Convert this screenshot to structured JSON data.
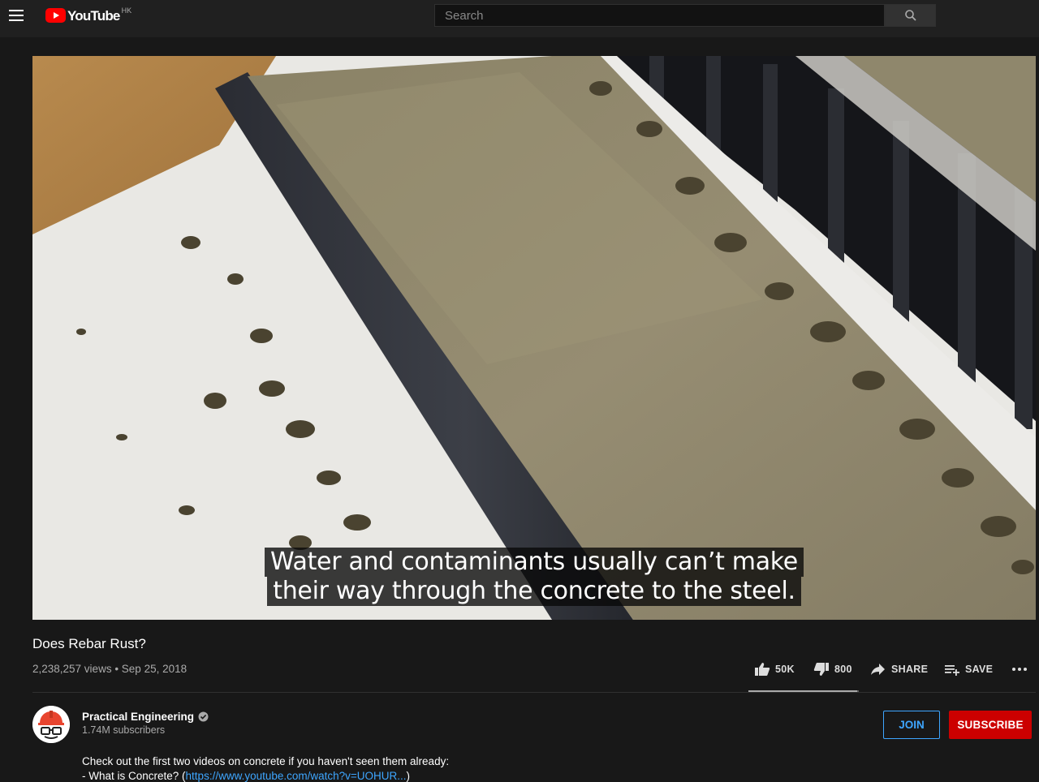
{
  "header": {
    "logo_text": "YouTube",
    "region": "HK",
    "search_placeholder": "Search"
  },
  "video": {
    "captions": [
      "Water and contaminants usually can’t make",
      "their way through the concrete to the steel."
    ]
  },
  "info": {
    "title": "Does Rebar Rust?",
    "meta": "2,238,257 views • Sep 25, 2018",
    "likes": "50K",
    "dislikes": "800",
    "share_label": "SHARE",
    "save_label": "SAVE",
    "like_ratio": 0.984
  },
  "channel": {
    "name": "Practical Engineering",
    "subscribers": "1.74M subscribers",
    "join_label": "JOIN",
    "subscribe_label": "SUBSCRIBE"
  },
  "description": {
    "line1": "Check out the first two videos on concrete if you haven't seen them already:",
    "line2_prefix": "- What is Concrete? (",
    "line2_link": "https://www.youtube.com/watch?v=UOHUR...",
    "line2_suffix": ")"
  },
  "colors": {
    "background": "#181818",
    "topbar": "#202020",
    "accent_blue": "#3ea6ff",
    "subscribe_red": "#cc0000",
    "logo_red": "#ff0000"
  }
}
